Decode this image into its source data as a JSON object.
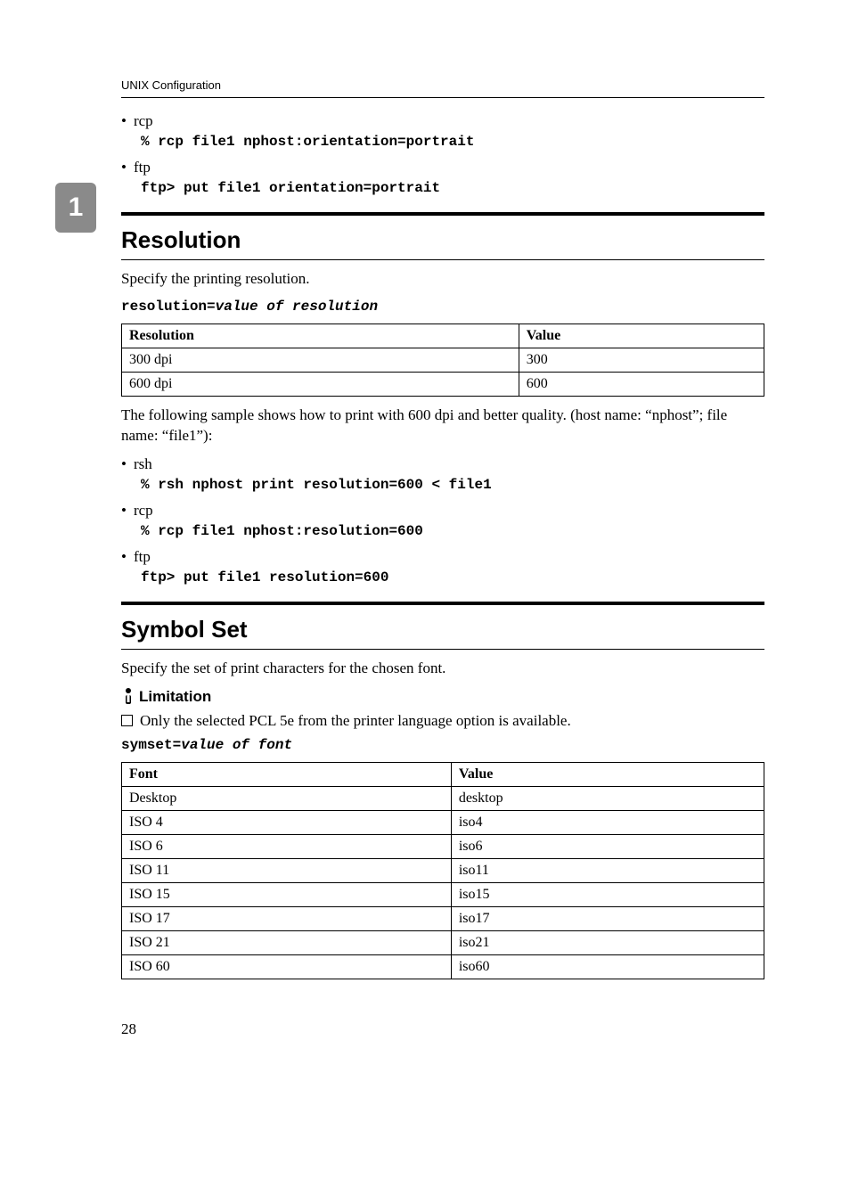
{
  "header": {
    "title": "UNIX Configuration"
  },
  "sideTab": "1",
  "intro": {
    "bullets": [
      {
        "label": "rcp",
        "code": "% rcp file1 nphost:orientation=portrait"
      },
      {
        "label": "ftp",
        "code": "ftp> put file1 orientation=portrait"
      }
    ]
  },
  "resolution": {
    "heading": "Resolution",
    "desc": "Specify the printing resolution.",
    "syntax_prefix": "resolution=",
    "syntax_ital": "value of resolution",
    "table": {
      "headers": [
        "Resolution",
        "Value"
      ],
      "rows": [
        [
          "300 dpi",
          "300"
        ],
        [
          "600 dpi",
          "600"
        ]
      ]
    },
    "sample": "The following sample shows how to print with 600 dpi and better quality. (host name: “nphost”; file name: “file1”):",
    "bullets": [
      {
        "label": "rsh",
        "code": "% rsh nphost print resolution=600 < file1"
      },
      {
        "label": "rcp",
        "code": "% rcp file1 nphost:resolution=600"
      },
      {
        "label": "ftp",
        "code": "ftp> put file1 resolution=600"
      }
    ]
  },
  "symbolset": {
    "heading": "Symbol Set",
    "desc": "Specify the set of print characters for the chosen font.",
    "limitation_label": "Limitation",
    "limitation_text": "Only the selected PCL 5e from the printer language option is available.",
    "syntax_prefix": "symset=",
    "syntax_ital": "value of font",
    "table": {
      "headers": [
        "Font",
        "Value"
      ],
      "rows": [
        [
          "Desktop",
          "desktop"
        ],
        [
          "ISO 4",
          "iso4"
        ],
        [
          "ISO 6",
          "iso6"
        ],
        [
          "ISO 11",
          "iso11"
        ],
        [
          "ISO 15",
          "iso15"
        ],
        [
          "ISO 17",
          "iso17"
        ],
        [
          "ISO 21",
          "iso21"
        ],
        [
          "ISO 60",
          "iso60"
        ]
      ]
    }
  },
  "pageNumber": "28"
}
